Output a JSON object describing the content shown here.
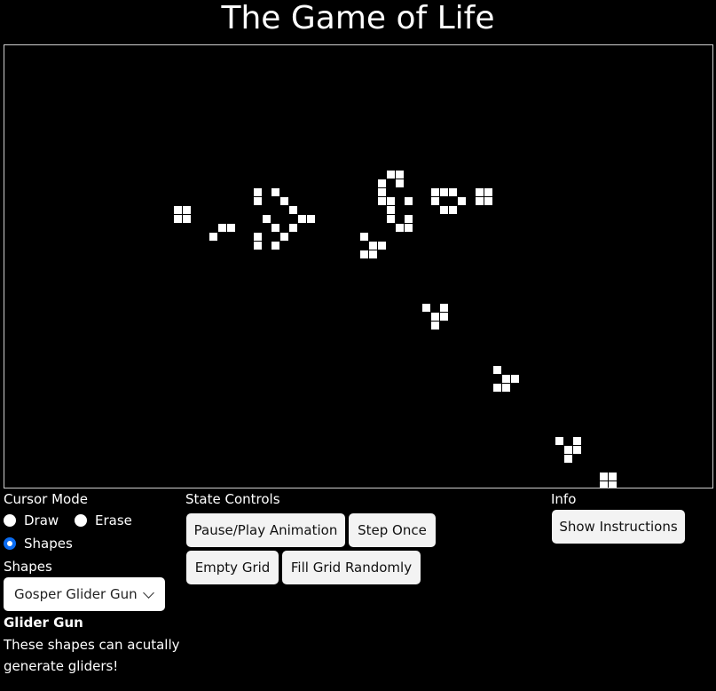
{
  "title": "The Game of Life",
  "cursor_mode": {
    "label": "Cursor Mode",
    "options": [
      {
        "label": "Draw",
        "checked": false
      },
      {
        "label": "Erase",
        "checked": false
      },
      {
        "label": "Shapes",
        "checked": true
      }
    ]
  },
  "state_controls": {
    "label": "State Controls",
    "buttons": {
      "pause_play": "Pause/Play Animation",
      "step_once": "Step Once",
      "empty_grid": "Empty Grid",
      "fill_random": "Fill Grid Randomly"
    }
  },
  "info": {
    "label": "Info",
    "show_instructions": "Show Instructions"
  },
  "shapes": {
    "label": "Shapes",
    "selected": "Gosper Glider Gun",
    "description_title": "Glider Gun",
    "description_text": "These shapes can acutally generate gliders!"
  },
  "colors": {
    "cell": "#ffffff",
    "board_background": "#000000",
    "radio_accent": "#0a6cf2"
  },
  "icons": {
    "select_chevron": "chevron-down-icon"
  }
}
